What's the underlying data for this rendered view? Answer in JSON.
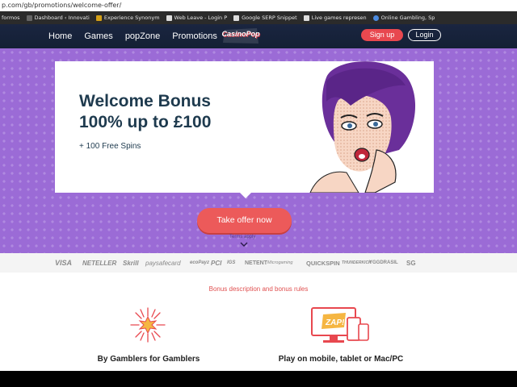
{
  "browser": {
    "url": "p.com/gb/promotions/welcome-offer/",
    "bookmarks": [
      {
        "label": "formos",
        "icon": "dash-icon"
      },
      {
        "label": "Dashboard ‹ Innovati",
        "icon": "wordpress-icon"
      },
      {
        "label": "Experience Synonym",
        "icon": "bookmark-icon"
      },
      {
        "label": "Web Leave - Login P",
        "icon": "document-icon"
      },
      {
        "label": "Google SERP Snippet",
        "icon": "document-icon"
      },
      {
        "label": "Live games represen",
        "icon": "document-icon"
      },
      {
        "label": "Online Gambling, Sp",
        "icon": "globe-icon"
      }
    ]
  },
  "nav": {
    "links": [
      "Home",
      "Games",
      "popZone",
      "Promotions"
    ],
    "logo": "CasinoPop",
    "signup": "Sign up",
    "login": "Login"
  },
  "hero": {
    "title": "Welcome Bonus",
    "amount": "100% up to £100",
    "spins": "+ 100 Free Spins",
    "cta": "Take offer now",
    "terms": "Terms apply"
  },
  "payments": [
    "VISA",
    "NETELLER",
    "Skrill",
    "paysafecard",
    "ecoPayz",
    "PCI",
    "IGS",
    "NETENT",
    "Microgaming",
    "QUICKSPIN",
    "THUNDERKICK",
    "YGGDRASIL",
    "SG"
  ],
  "lower": {
    "bonus_link": "Bonus description and bonus rules",
    "feature_left": "By Gamblers for Gamblers",
    "feature_right": "Play on mobile, tablet or Mac/PC",
    "zap": "ZAP!"
  },
  "colors": {
    "hero_purple": "#9b6bd6",
    "cta_red": "#ec5a5a",
    "navy": "#1a2540",
    "heading": "#1e3a4e"
  }
}
